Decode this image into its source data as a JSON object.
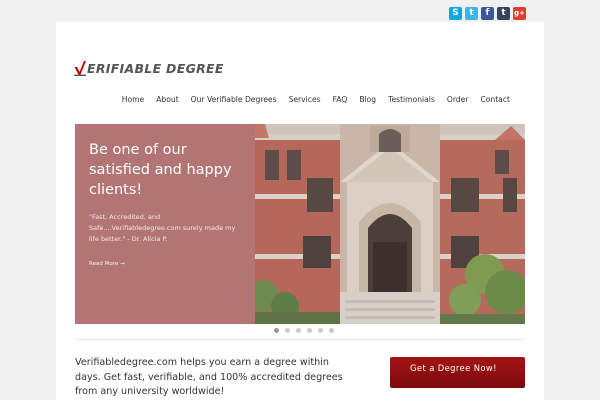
{
  "social": {
    "skype_label": "S",
    "twitter_label": "t",
    "facebook_label": "f",
    "tumblr_label": "t",
    "googleplus_label": "g+"
  },
  "brand": {
    "logo_text": "ERIFIABLE DEGREE",
    "accent_color": "#c00000"
  },
  "nav": {
    "items": [
      "Home",
      "About",
      "Our Verifiable Degrees",
      "Services",
      "FAQ",
      "Blog",
      "Testimonials",
      "Order",
      "Contact"
    ]
  },
  "slider": {
    "title": "Be one of our satisfied and happy clients!",
    "quote": "\"Fast, Accredited, and Safe....Verifiabledegree.com surely made my life better.\" - Dr. Alicia P.",
    "link_label": "Read More →",
    "panel_color": "#b27574",
    "dots_count": 6
  },
  "intro": {
    "text": "Verifiabledegree.com helps you earn a degree within days. Get fast, verifiable, and 100% accredited degrees from any university worldwide!"
  },
  "cta": {
    "label": "Get a Degree Now!"
  }
}
